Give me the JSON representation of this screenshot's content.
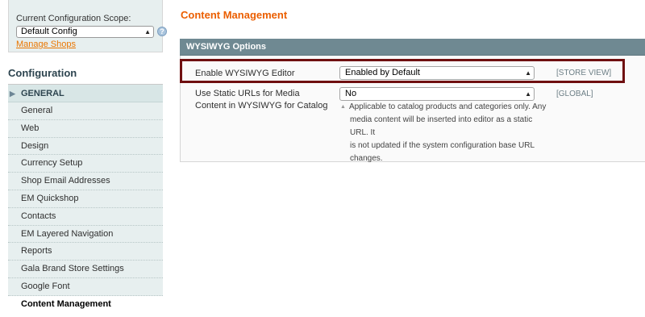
{
  "sidebar": {
    "scope_label": "Current Configuration Scope:",
    "scope_value": "Default Config",
    "manage_link": "Manage Shops",
    "config_title": "Configuration",
    "group_label": "GENERAL",
    "items": [
      {
        "label": "General"
      },
      {
        "label": "Web"
      },
      {
        "label": "Design"
      },
      {
        "label": "Currency Setup"
      },
      {
        "label": "Shop Email Addresses"
      },
      {
        "label": "EM Quickshop"
      },
      {
        "label": "Contacts"
      },
      {
        "label": "EM Layered Navigation"
      },
      {
        "label": "Reports"
      },
      {
        "label": "Gala Brand Store Settings"
      },
      {
        "label": "Google Font"
      },
      {
        "label": "Content Management"
      }
    ]
  },
  "main": {
    "title": "Content Management",
    "section_title": "WYSIWYG Options",
    "fields": [
      {
        "label": "Enable WYSIWYG Editor",
        "value": "Enabled by Default",
        "scope": "[STORE VIEW]"
      },
      {
        "label_line1": "Use Static URLs for Media",
        "label_line2": "Content in WYSIWYG for Catalog",
        "value": "No",
        "scope": "[GLOBAL]",
        "hint_lines": [
          "Applicable to catalog products and categories only. Any",
          "media content will be inserted into editor as a static URL. It",
          "is not updated if the system configuration base URL",
          "changes."
        ]
      }
    ]
  },
  "colors": {
    "accent_orange": "#eb5e00",
    "section_header": "#6f8992",
    "highlight_box": "#6f0f10",
    "sidebar_bg": "#e7efef"
  }
}
